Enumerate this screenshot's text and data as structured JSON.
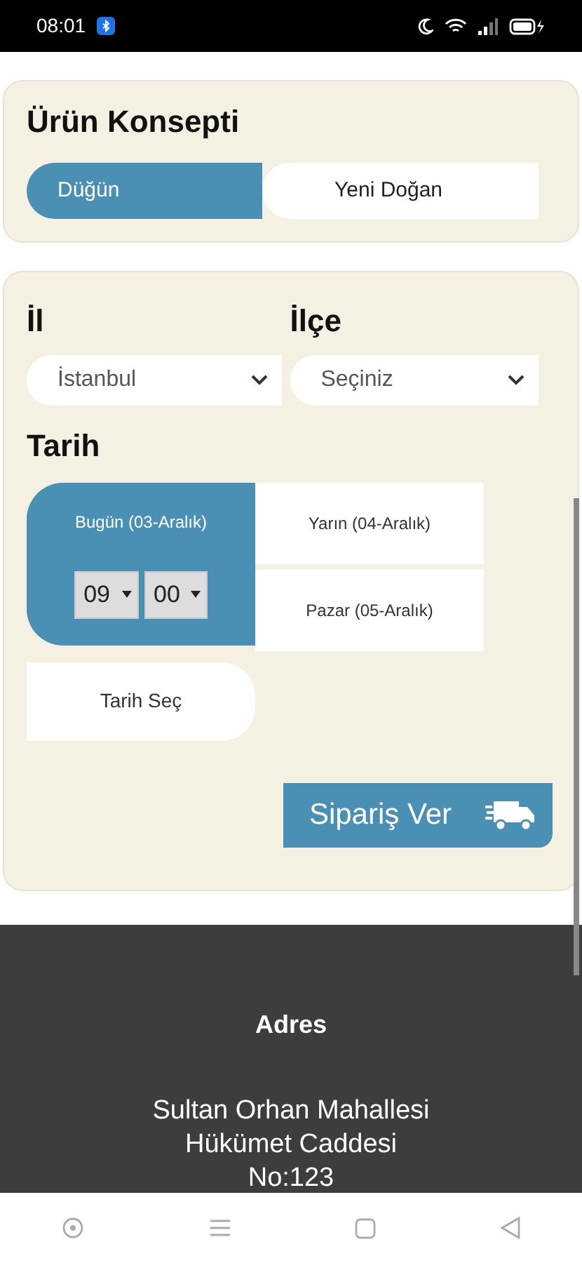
{
  "status_bar": {
    "time": "08:01"
  },
  "concept": {
    "title": "Ürün Konsepti",
    "options": [
      {
        "label": "Düğün",
        "selected": true
      },
      {
        "label": "Yeni Doğan",
        "selected": false
      }
    ]
  },
  "location": {
    "fields": [
      {
        "label": "İl",
        "value": "İstanbul"
      },
      {
        "label": "İlçe",
        "value": "Seçiniz"
      }
    ]
  },
  "date": {
    "title": "Tarih",
    "options": [
      {
        "label": "Bugün (03-Aralık)",
        "selected": true
      },
      {
        "label": "Yarın (04-Aralık)",
        "selected": false
      },
      {
        "label": "Pazar (05-Aralık)",
        "selected": false
      }
    ],
    "time": {
      "hour": "09",
      "minute": "00"
    },
    "pick_button": "Tarih Seç"
  },
  "order_button": "Sipariş Ver",
  "footer": {
    "title": "Adres",
    "lines": [
      "Sultan Orhan Mahallesi",
      "Hükümet Caddesi",
      "No:123"
    ]
  }
}
